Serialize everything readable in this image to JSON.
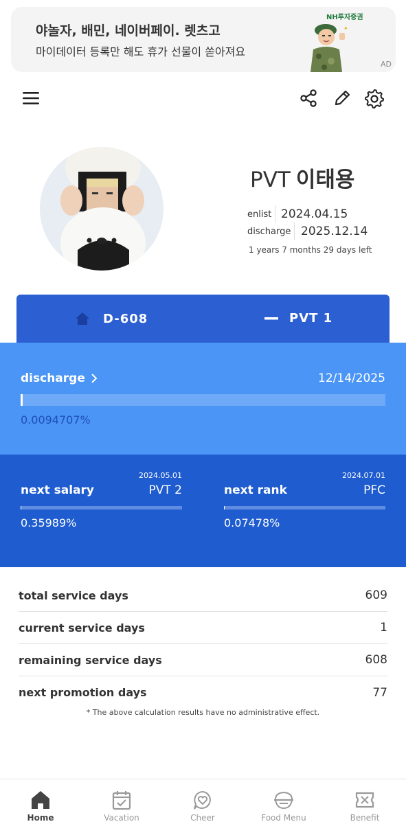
{
  "ad": {
    "title": "야놀자, 배민, 네이버페이. 렛츠고",
    "subtitle": "마이데이터 등록만 해도 휴가 선물이 쏟아져요",
    "tag": "AD",
    "logo": "NH투자증권"
  },
  "toolbar": {
    "menu_icon": "hamburger-menu-icon",
    "share_icon": "share-icon",
    "edit_icon": "pencil-icon",
    "settings_icon": "gear-icon"
  },
  "profile": {
    "rank": "PVT",
    "name": "이태용",
    "enlist_label": "enlist",
    "enlist_date": "2024.04.15",
    "discharge_label": "discharge",
    "discharge_date": "2025.12.14",
    "time_left": "1 years 7 months 29 days left"
  },
  "tabs": [
    {
      "icon": "home-icon",
      "label": "D-608"
    },
    {
      "icon": "rank-bar-icon",
      "label": "PVT 1"
    }
  ],
  "discharge": {
    "label": "discharge",
    "date": "12/14/2025",
    "percent_text": "0.0094707%",
    "progress_fraction": 9.4707e-05
  },
  "next_salary": {
    "date": "2024.05.01",
    "label": "next salary",
    "value": "PVT 2",
    "percent_text": "0.35989%",
    "progress_fraction": 0.0035989
  },
  "next_rank": {
    "date": "2024.07.01",
    "label": "next rank",
    "value": "PFC",
    "percent_text": "0.07478%",
    "progress_fraction": 0.0007478
  },
  "stats": [
    {
      "label": "total service days",
      "value": "609"
    },
    {
      "label": "current service days",
      "value": "1"
    },
    {
      "label": "remaining service days",
      "value": "608"
    },
    {
      "label": "next promotion days",
      "value": "77"
    }
  ],
  "disclaimer": "* The above calculation results have no administrative effect.",
  "nav": [
    {
      "label": "Home",
      "icon": "home-icon",
      "active": true
    },
    {
      "label": "Vacation",
      "icon": "calendar-check-icon",
      "active": false
    },
    {
      "label": "Cheer",
      "icon": "heart-chat-icon",
      "active": false
    },
    {
      "label": "Food Menu",
      "icon": "rice-bowl-icon",
      "active": false
    },
    {
      "label": "Benefit",
      "icon": "ticket-icon",
      "active": false
    }
  ],
  "colors": {
    "primary_blue": "#2c5fd1",
    "light_blue": "#4a95f5",
    "dark_blue": "#1f5ccf",
    "ad_bg": "#f4f4f4"
  }
}
